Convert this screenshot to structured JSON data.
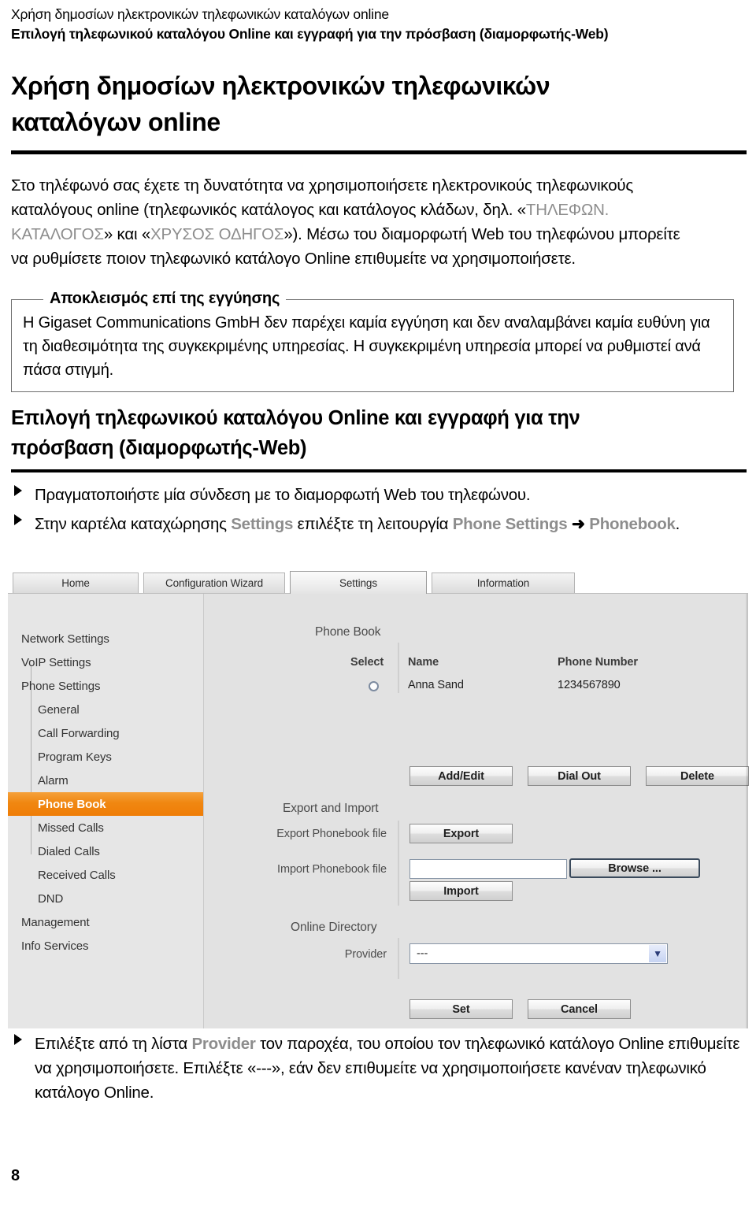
{
  "document": {
    "running_head_line1": "Χρήση δημοσίων ηλεκτρονικών τηλεφωνικών καταλόγων online",
    "running_head_line2": "Επιλογή τηλεφωνικού καταλόγου Online και εγγραφή για την πρόσβαση (διαμορφωτής-Web)",
    "page_number": "8"
  },
  "section1": {
    "heading": "Χρήση δημοσίων ηλεκτρονικών τηλεφωνικών καταλόγων online",
    "intro_part1": "Στο τηλέφωνό σας έχετε τη δυνατότητα να χρησιμοποιήσετε ηλεκτρονικούς τηλεφωνικούς καταλόγους online (τηλεφωνικός κατάλογος και κατάλογος κλάδων, δηλ. «",
    "intro_kw1": "ΤΗΛΕΦΩΝ. ΚΑΤΑΛΟΓΟΣ",
    "intro_part2": "» και «",
    "intro_kw2": "ΧΡΥΣΟΣ ΟΔΗΓΟΣ",
    "intro_part3": "»). Μέσω του διαμορφωτή Web του τηλεφώνου μπορείτε να ρυθμίσετε ποιον τηλεφωνικό κατάλογο Online επιθυμείτε να χρησιμοποιήσετε."
  },
  "disclaimer": {
    "legend": "Αποκλεισμός επί της εγγύησης",
    "body": "Η Gigaset Communications GmbH δεν παρέχει καμία εγγύηση και δεν αναλαμβάνει καμία ευθύνη για τη διαθεσιμότητα της συγκεκριμένης υπηρεσίας. Η συγκεκριμένη υπηρεσία μπορεί να ρυθμιστεί ανά πάσα στιγμή."
  },
  "section2": {
    "heading": "Επιλογή τηλεφωνικού καταλόγου Online και εγγραφή για την πρόσβαση (διαμορφωτής-Web)",
    "bullet1": "Πραγματοποιήστε μία σύνδεση με το διαμορφωτή Web του τηλεφώνου.",
    "bullet2_part1": "Στην καρτέλα καταχώρησης ",
    "bullet2_kw1": "Settings",
    "bullet2_part2": " επιλέξτε τη λειτουργία ",
    "bullet2_kw2": "Phone Settings",
    "bullet2_arrow": "➜",
    "bullet2_kw3": "Phonebook",
    "bullet2_part3": "."
  },
  "section3": {
    "bullet1_part1": "Επιλέξτε από τη λίστα ",
    "bullet1_kw1": "Provider",
    "bullet1_part2": " τον παροχέα, του οποίου τον τηλεφωνικό κατάλογο Online επιθυμείτε να χρησιμοποιήσετε. Επιλέξτε «---», εάν δεν επιθυμείτε να χρησιμοποιήσετε κανέναν τηλεφωνικό κατάλογο Online."
  },
  "screenshot": {
    "tabs": [
      {
        "label": "Home",
        "active": false
      },
      {
        "label": "Configuration Wizard",
        "active": false
      },
      {
        "label": "Settings",
        "active": true
      },
      {
        "label": "Information",
        "active": false
      }
    ],
    "sidebar": [
      {
        "label": "Network Settings",
        "level": 0,
        "selected": false
      },
      {
        "label": "VoIP Settings",
        "level": 0,
        "selected": false
      },
      {
        "label": "Phone Settings",
        "level": 0,
        "selected": false
      },
      {
        "label": "General",
        "level": 1,
        "selected": false
      },
      {
        "label": "Call Forwarding",
        "level": 1,
        "selected": false
      },
      {
        "label": "Program Keys",
        "level": 1,
        "selected": false
      },
      {
        "label": "Alarm",
        "level": 1,
        "selected": false
      },
      {
        "label": "Phone Book",
        "level": 1,
        "selected": true
      },
      {
        "label": "Missed Calls",
        "level": 1,
        "selected": false
      },
      {
        "label": "Dialed Calls",
        "level": 1,
        "selected": false
      },
      {
        "label": "Received Calls",
        "level": 1,
        "selected": false
      },
      {
        "label": "DND",
        "level": 1,
        "selected": false
      },
      {
        "label": "Management",
        "level": 0,
        "selected": false
      },
      {
        "label": "Info Services",
        "level": 0,
        "selected": false
      }
    ],
    "phone_book": {
      "section_title": "Phone Book",
      "columns": [
        "Select",
        "Name",
        "Phone Number"
      ],
      "rows": [
        {
          "name": "Anna Sand",
          "phone": "1234567890",
          "selected": false
        }
      ],
      "buttons": [
        "Add/Edit",
        "Dial Out",
        "Delete"
      ]
    },
    "export_import": {
      "section_title": "Export and Import",
      "export_label": "Export Phonebook file",
      "export_button": "Export",
      "import_label": "Import Phonebook file",
      "import_value": "",
      "browse_button": "Browse ...",
      "import_button": "Import"
    },
    "online_directory": {
      "section_title": "Online Directory",
      "provider_label": "Provider",
      "provider_value": "---",
      "set_button": "Set",
      "cancel_button": "Cancel"
    },
    "colors": {
      "selected_nav": "#F08711",
      "panel_bg": "#E2E2E2",
      "sidebar_bg": "#E6E6E6"
    }
  }
}
